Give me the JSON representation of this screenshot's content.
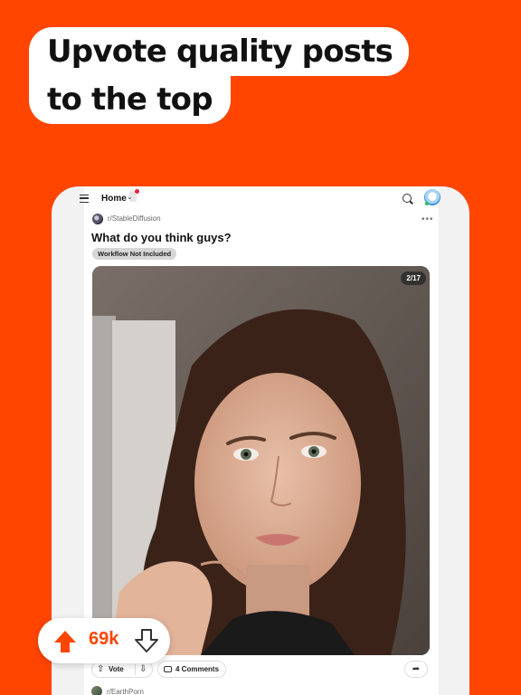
{
  "headline": {
    "line1": "Upvote quality posts",
    "line2": "to the top"
  },
  "topbar": {
    "menu_icon": "hamburger-icon",
    "home_label": "Home",
    "chevron": "⌄",
    "search_icon": "search-icon",
    "avatar_icon": "snoo-avatar-icon"
  },
  "post": {
    "subreddit": "r/StableDiffusion",
    "more": "•••",
    "title": "What do you think guys?",
    "flair": "Workflow Not Included",
    "image_counter": "2/17",
    "vote_label": "Vote",
    "comments_label": "4 Comments"
  },
  "next_post": {
    "subreddit": "r/EarthPorn"
  },
  "vote_bubble": {
    "count": "69k"
  },
  "colors": {
    "brand": "#FF4500",
    "flair_bg": "#D6D6D6",
    "text": "#111111"
  }
}
